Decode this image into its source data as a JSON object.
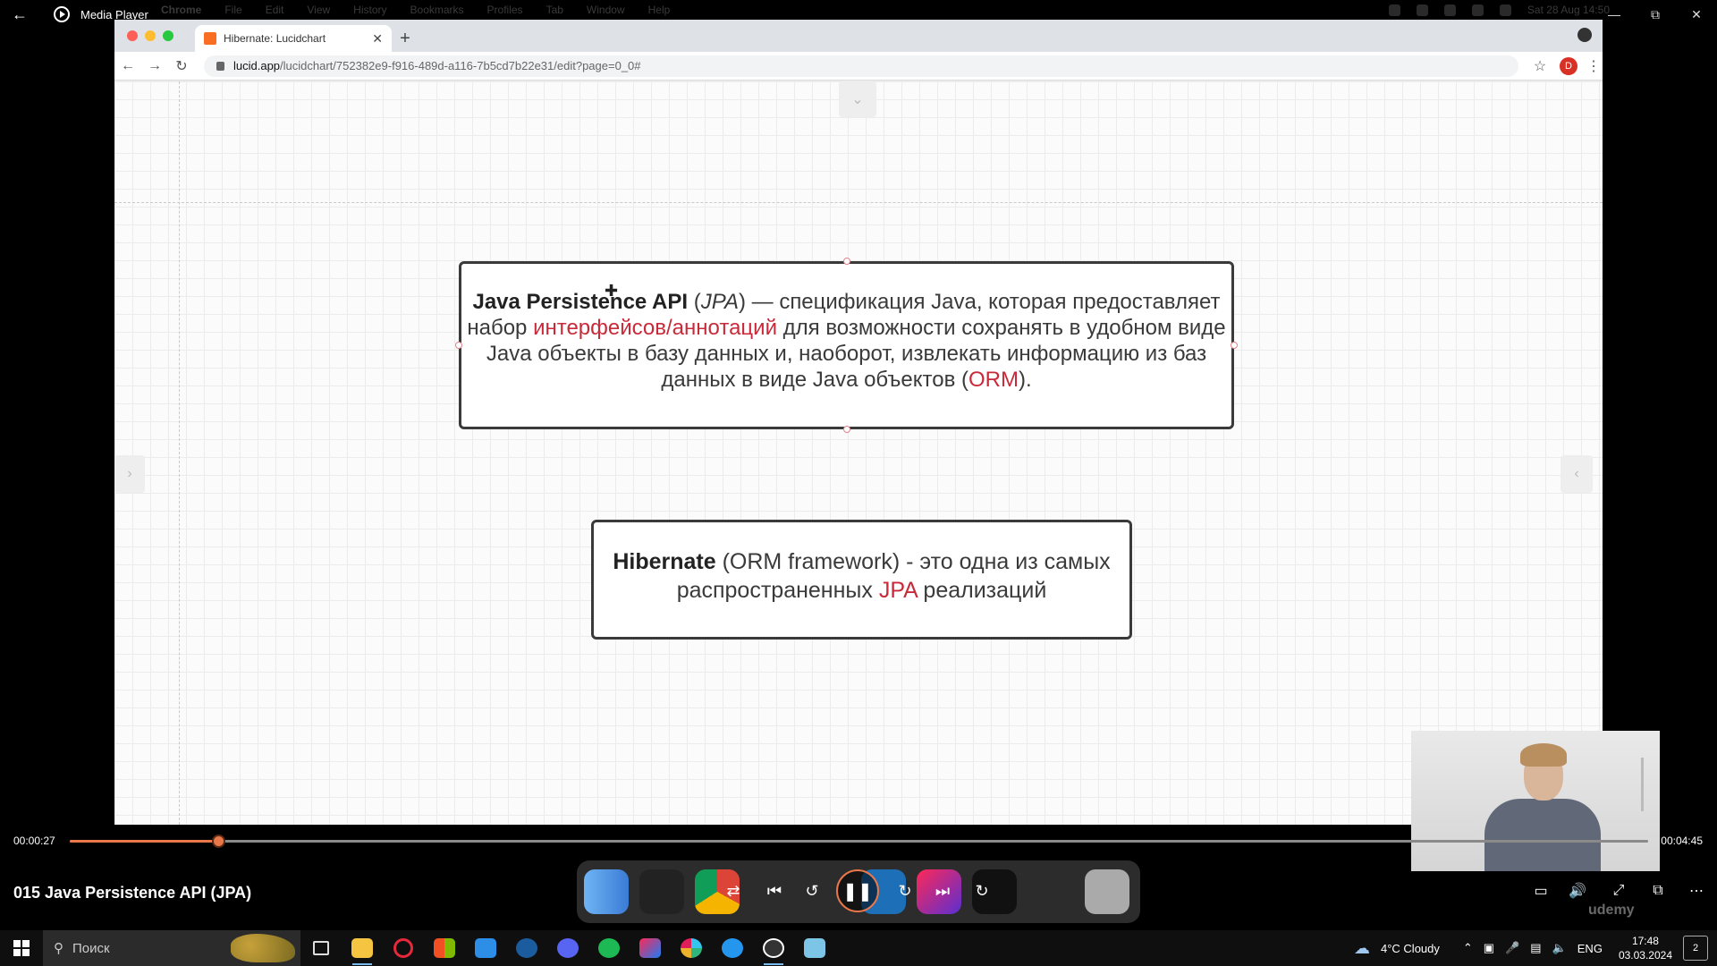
{
  "player": {
    "app_title": "Media Player",
    "video_title": "015 Java Persistence API (JPA)",
    "time_current": "00:00:27",
    "time_duration": "00:04:45",
    "progress_fraction": 0.094,
    "watermark": "udemy"
  },
  "mac_menubar": {
    "items": [
      "Chrome",
      "File",
      "Edit",
      "View",
      "History",
      "Bookmarks",
      "Profiles",
      "Tab",
      "Window",
      "Help"
    ],
    "datetime": "Sat 28 Aug  14:50"
  },
  "browser": {
    "tab_title": "Hibernate: Lucidchart",
    "url_host": "lucid.app",
    "url_path": "/lucidchart/752382e9-f916-489d-a116-7b5cd7b22e31/edit?page=0_0#",
    "profile_initial": "D"
  },
  "diagram": {
    "box1": {
      "bold": "Java Persistence API",
      "open_paren": " (",
      "italic": "JPA",
      "text_1": ") — спецификация Java, которая предоставляет набор ",
      "red_1": "интерфейсов/аннотаций",
      "text_2": " для возможности сохранять в удобном виде Java объекты в базу данных и, наоборот, извлекать информацию из баз данных в виде Java объектов (",
      "red_2": "ORM",
      "text_3": ")."
    },
    "box2": {
      "bold": "Hibernate",
      "text_1": " (ORM framework) - это одна из самых распространенных ",
      "red_1": "JPA",
      "text_2": " реализаций"
    }
  },
  "taskbar": {
    "search_placeholder": "Поиск",
    "weather": "4°C  Cloudy",
    "language": "ENG",
    "time": "17:48",
    "date": "03.03.2024",
    "notification_count": "2"
  },
  "colors": {
    "accent": "#e8784a",
    "highlight_red": "#c92a3a"
  }
}
